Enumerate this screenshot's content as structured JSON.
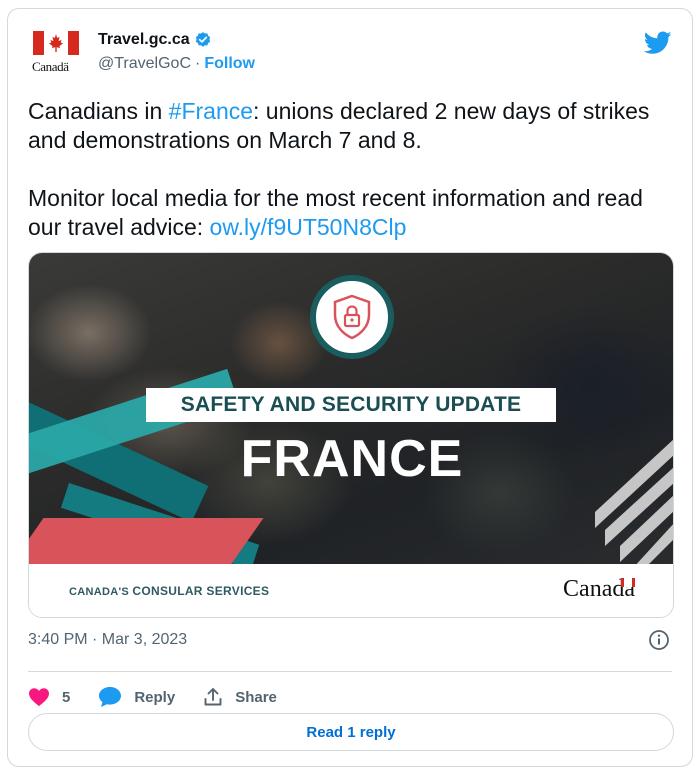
{
  "account": {
    "display_name": "Travel.gc.ca",
    "handle": "@TravelGoC",
    "separator": "·",
    "follow_label": "Follow",
    "avatar_wordmark": "Canadä"
  },
  "tweet": {
    "line1_prefix": "Canadians in ",
    "hashtag": "#France",
    "line1_suffix": ": unions declared 2 new days of strikes and demonstrations on March 7 and 8.",
    "line2_prefix": "Monitor local media for the most recent information and read our travel advice: ",
    "link": "ow.ly/f9UT50N8Clp"
  },
  "media": {
    "banner": "SAFETY AND SECURITY UPDATE",
    "country": "FRANCE",
    "footer_left_prefix": "CANADA'S ",
    "footer_left_main": "CONSULAR SERVICES",
    "footer_right": "Canadä"
  },
  "meta": {
    "timestamp": "3:40 PM · Mar 3, 2023"
  },
  "actions": {
    "likes": "5",
    "reply_label": "Reply",
    "share_label": "Share"
  },
  "read_reply_label": "Read 1 reply",
  "colors": {
    "link": "#1d9bf0",
    "like": "#f91880",
    "reply_icon": "#1d9bf0",
    "teal": "#1a5d5f",
    "red": "#d52b1e"
  }
}
